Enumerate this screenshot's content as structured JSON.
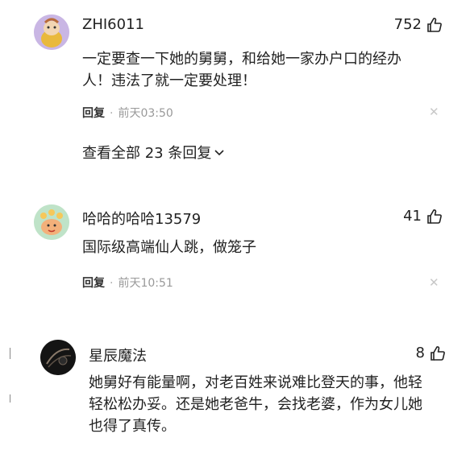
{
  "comments": [
    {
      "username": "ZHI6011",
      "likes": "752",
      "text_lines": [
        "一定要查一下她的舅舅，和给她一家办户口的经办",
        "人！违法了就一定要处理！"
      ],
      "reply_label": "回复",
      "time": "前天03:50",
      "avatar_icon": "cartoon-avatar-yellow",
      "view_all": "查看全部 23 条回复"
    },
    {
      "username": "哈哈的哈哈13579",
      "likes": "41",
      "text_lines": [
        "国际级高端仙人跳，做笼子"
      ],
      "reply_label": "回复",
      "time": "前天10:51",
      "avatar_icon": "cartoon-avatar-green"
    },
    {
      "username": "星辰魔法",
      "likes": "8",
      "text_lines": [
        "她舅好有能量啊，对老百姓来说难比登天的事，他轻",
        "轻松松办妥。还是她老爸牛，会找老婆，作为女儿她",
        "也得了真传。"
      ],
      "avatar_icon": "dark-swirl-avatar"
    }
  ],
  "icons": {
    "like": "thumbs-up-icon",
    "close": "close-icon",
    "expand": "chevron-down-icon"
  },
  "colors": {
    "text": "#222222",
    "meta": "#999999",
    "reply": "#333333",
    "close": "#c8c8c8"
  }
}
